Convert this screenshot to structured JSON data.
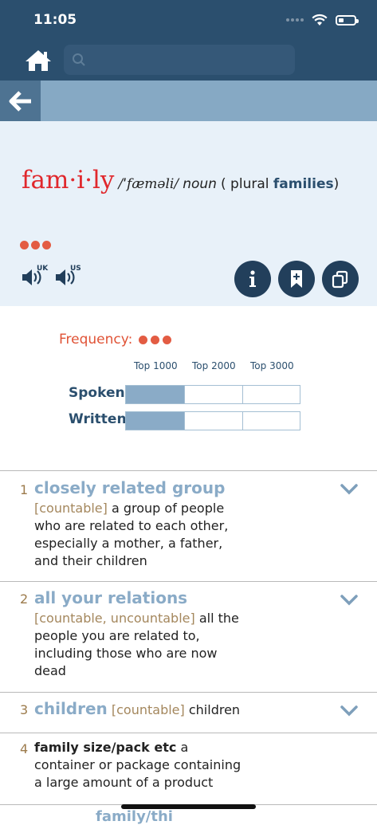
{
  "status_bar": {
    "time": "11:05"
  },
  "search": {
    "placeholder": "",
    "value": ""
  },
  "entry": {
    "headword": "fam·i·ly",
    "pronunciation": "/ˈfæməli/",
    "part_of_speech": "noun",
    "plural_prefix": "( plural",
    "plural_form": "families",
    "plural_suffix": ")",
    "frequency_level": 3,
    "audio": [
      {
        "label": "UK",
        "icon": "speaker-uk-icon"
      },
      {
        "label": "US",
        "icon": "speaker-us-icon"
      }
    ]
  },
  "frequency": {
    "label": "Frequency:",
    "tiers": [
      "Top 1000",
      "Top 2000",
      "Top 3000"
    ],
    "rows": [
      {
        "label": "Spoken",
        "level": 1
      },
      {
        "label": "Written",
        "level": 1
      }
    ]
  },
  "senses": [
    {
      "number": "1",
      "signpost": "closely related group",
      "grammar": "[countable]",
      "definition_lines": [
        "a group of people",
        "who are related to each other,",
        "especially a mother, a father,",
        "and their children"
      ]
    },
    {
      "number": "2",
      "signpost": "all your relations",
      "grammar": "[countable, uncountable]",
      "definition_lines": [
        "all the",
        "people you are related to,",
        "including those who are now",
        "dead"
      ]
    },
    {
      "number": "3",
      "signpost": "children",
      "grammar": "[countable]",
      "definition": "children"
    },
    {
      "number": "4",
      "bold_phrase": "family size/pack etc",
      "definition_lines": [
        "a",
        "container or package containing",
        "a large amount of a product"
      ]
    }
  ],
  "next_peek": "family/thi"
}
